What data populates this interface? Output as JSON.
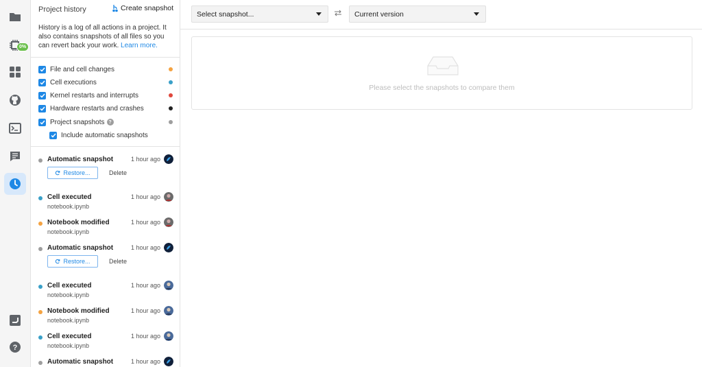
{
  "rail": {
    "badge": "0%",
    "items": [
      "folder-icon",
      "chip-icon",
      "grid-icon",
      "github-icon",
      "terminal-icon",
      "notes-icon",
      "history-icon"
    ],
    "bottom": [
      "cloud-icon",
      "help-icon"
    ]
  },
  "sidebar": {
    "title": "Project history",
    "create_label": "Create snapshot",
    "description": "History is a log of all actions in a project. It also contains snapshots of all files so you can revert back your work.",
    "learn_more": "Learn more.",
    "filters": [
      {
        "label": "File and cell changes",
        "checked": true,
        "color": "#f4a342"
      },
      {
        "label": "Cell executions",
        "checked": true,
        "color": "#3aa0c8"
      },
      {
        "label": "Kernel restarts and interrupts",
        "checked": true,
        "color": "#e0483d"
      },
      {
        "label": "Hardware restarts and crashes",
        "checked": true,
        "color": "#222222"
      },
      {
        "label": "Project snapshots",
        "checked": true,
        "color": "#9e9e9e"
      }
    ],
    "include_auto": {
      "label": "Include automatic snapshots",
      "checked": true
    },
    "entries": [
      {
        "title": "Automatic snapshot",
        "time": "1 hour ago",
        "color": "#9e9e9e",
        "restore": "Restore...",
        "delete": "Delete"
      },
      {
        "title": "Cell executed",
        "time": "1 hour ago",
        "color": "#3aa0c8",
        "file": "notebook.ipynb"
      },
      {
        "title": "Notebook modified",
        "time": "1 hour ago",
        "color": "#f4a342",
        "file": "notebook.ipynb"
      },
      {
        "title": "Automatic snapshot",
        "time": "1 hour ago",
        "color": "#9e9e9e",
        "restore": "Restore...",
        "delete": "Delete"
      },
      {
        "title": "Cell executed",
        "time": "1 hour ago",
        "color": "#3aa0c8",
        "file": "notebook.ipynb"
      },
      {
        "title": "Notebook modified",
        "time": "1 hour ago",
        "color": "#f4a342",
        "file": "notebook.ipynb"
      },
      {
        "title": "Cell executed",
        "time": "1 hour ago",
        "color": "#3aa0c8",
        "file": "notebook.ipynb"
      },
      {
        "title": "Automatic snapshot",
        "time": "1 hour ago",
        "color": "#9e9e9e"
      }
    ]
  },
  "main": {
    "left_select": "Select snapshot...",
    "right_select": "Current version",
    "empty_message": "Please select the snapshots to compare them"
  },
  "colors": {
    "accent": "#1e88e5",
    "rail_active": "#d7e8fb"
  }
}
